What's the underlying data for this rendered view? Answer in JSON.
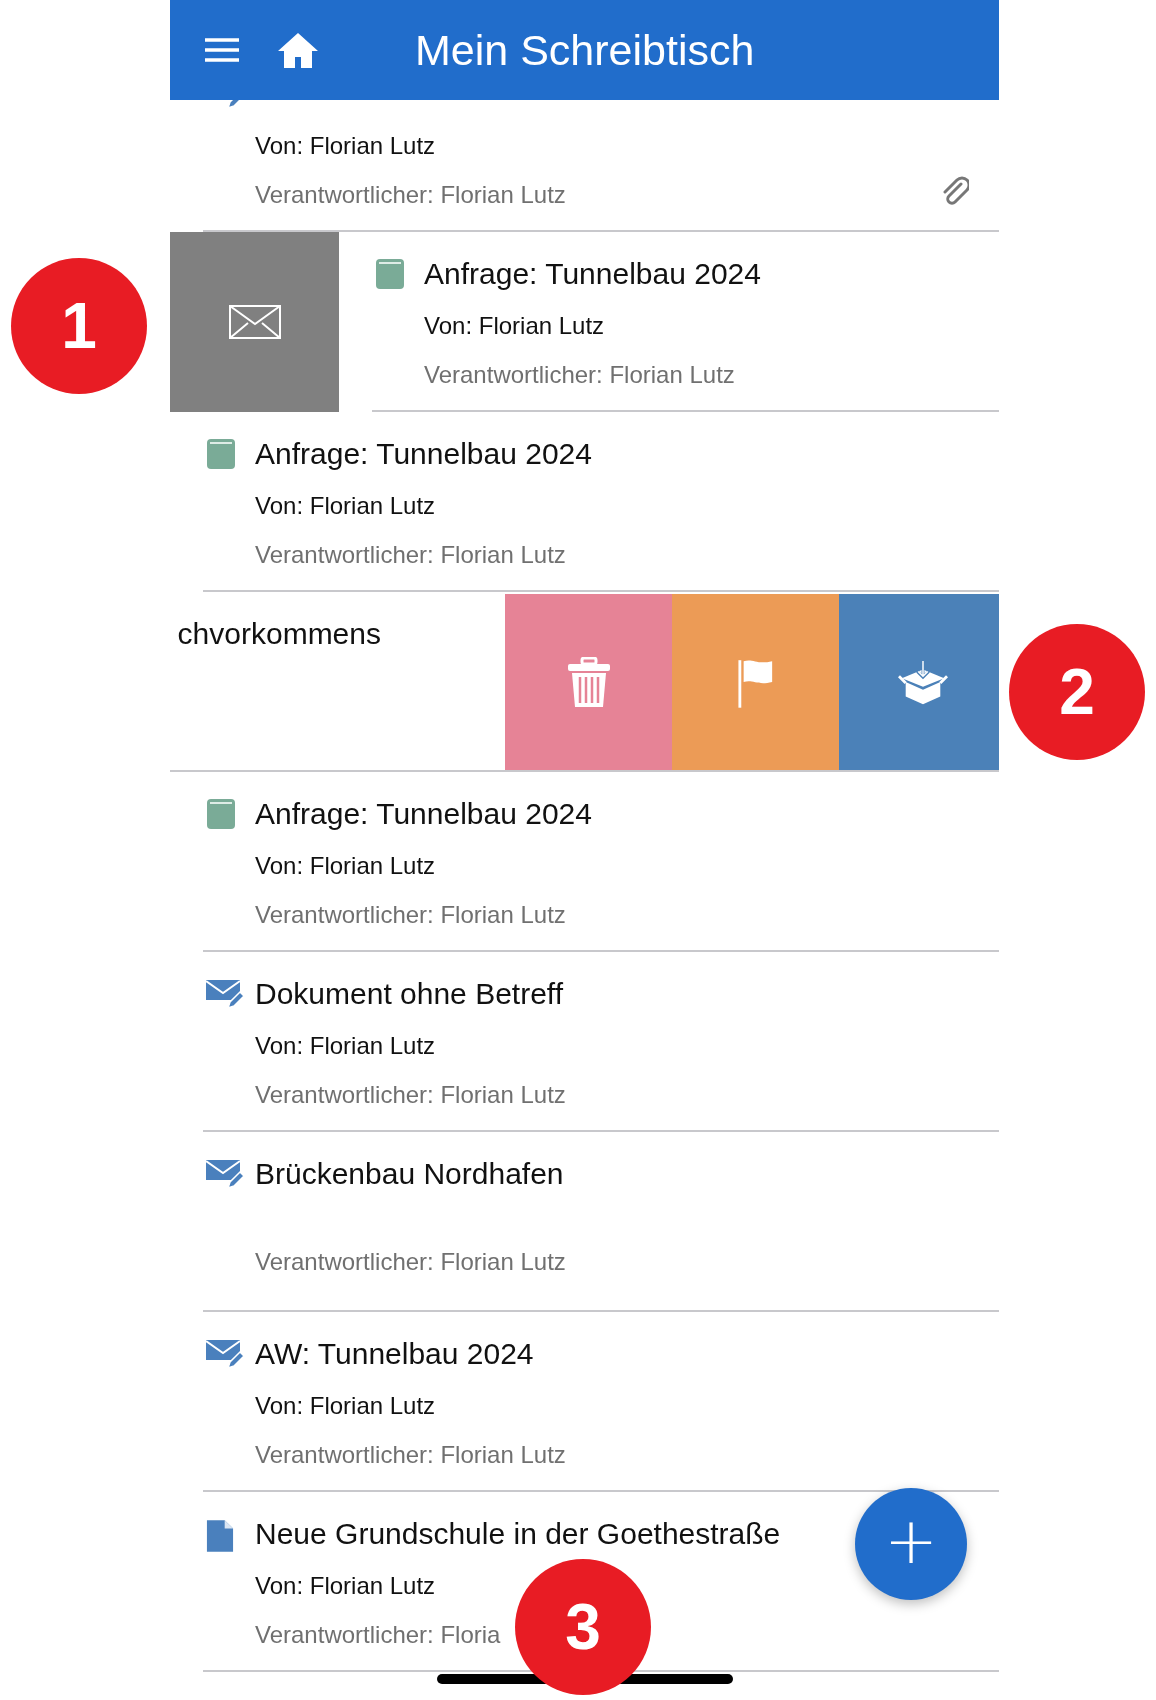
{
  "header": {
    "title": "Mein Schreibtisch"
  },
  "items": [
    {
      "kind": "mail-edit",
      "from": "Von: Florian Lutz",
      "owner": "Verantwortlicher: Florian Lutz",
      "attachment": true
    },
    {
      "kind": "book",
      "title": "Anfrage: Tunnelbau 2024",
      "from": "Von: Florian Lutz",
      "owner": "Verantwortlicher: Florian Lutz",
      "attachment": false,
      "leading_actions": [
        {
          "kind": "mail",
          "color": "#808080"
        }
      ]
    },
    {
      "kind": "book",
      "title": "Anfrage: Tunnelbau 2024",
      "from": "Von: Florian Lutz",
      "owner": "Verantwortlicher: Florian Lutz",
      "attachment": false
    },
    {
      "title": "chvorkommens",
      "attachment": false,
      "trailing_actions": [
        {
          "kind": "delete",
          "color": "#e68396"
        },
        {
          "kind": "flag",
          "color": "#ec9b56"
        },
        {
          "kind": "archive",
          "color": "#4b81b8"
        }
      ]
    },
    {
      "kind": "book",
      "title": "Anfrage: Tunnelbau 2024",
      "from": "Von: Florian Lutz",
      "owner": "Verantwortlicher: Florian Lutz",
      "attachment": false
    },
    {
      "kind": "mail-edit",
      "title": "Dokument ohne Betreff",
      "from": "Von: Florian Lutz",
      "owner": "Verantwortlicher: Florian Lutz",
      "attachment": false
    },
    {
      "kind": "mail-edit",
      "title": "Brückenbau Nordhafen",
      "owner": "Verantwortlicher: Florian Lutz",
      "attachment": false
    },
    {
      "kind": "mail-edit",
      "title": "AW: Tunnelbau 2024",
      "from": "Von: Florian Lutz",
      "owner": "Verantwortlicher: Florian Lutz",
      "attachment": false
    },
    {
      "kind": "document",
      "title": "Neue Grundschule in der Goethestraße",
      "from": "Von: Florian Lutz",
      "owner": "Verantwortlicher: Floria",
      "attachment": false
    }
  ],
  "fab": {
    "label": "+"
  },
  "callouts": [
    {
      "label": "1"
    },
    {
      "label": "2"
    },
    {
      "label": "3"
    }
  ]
}
